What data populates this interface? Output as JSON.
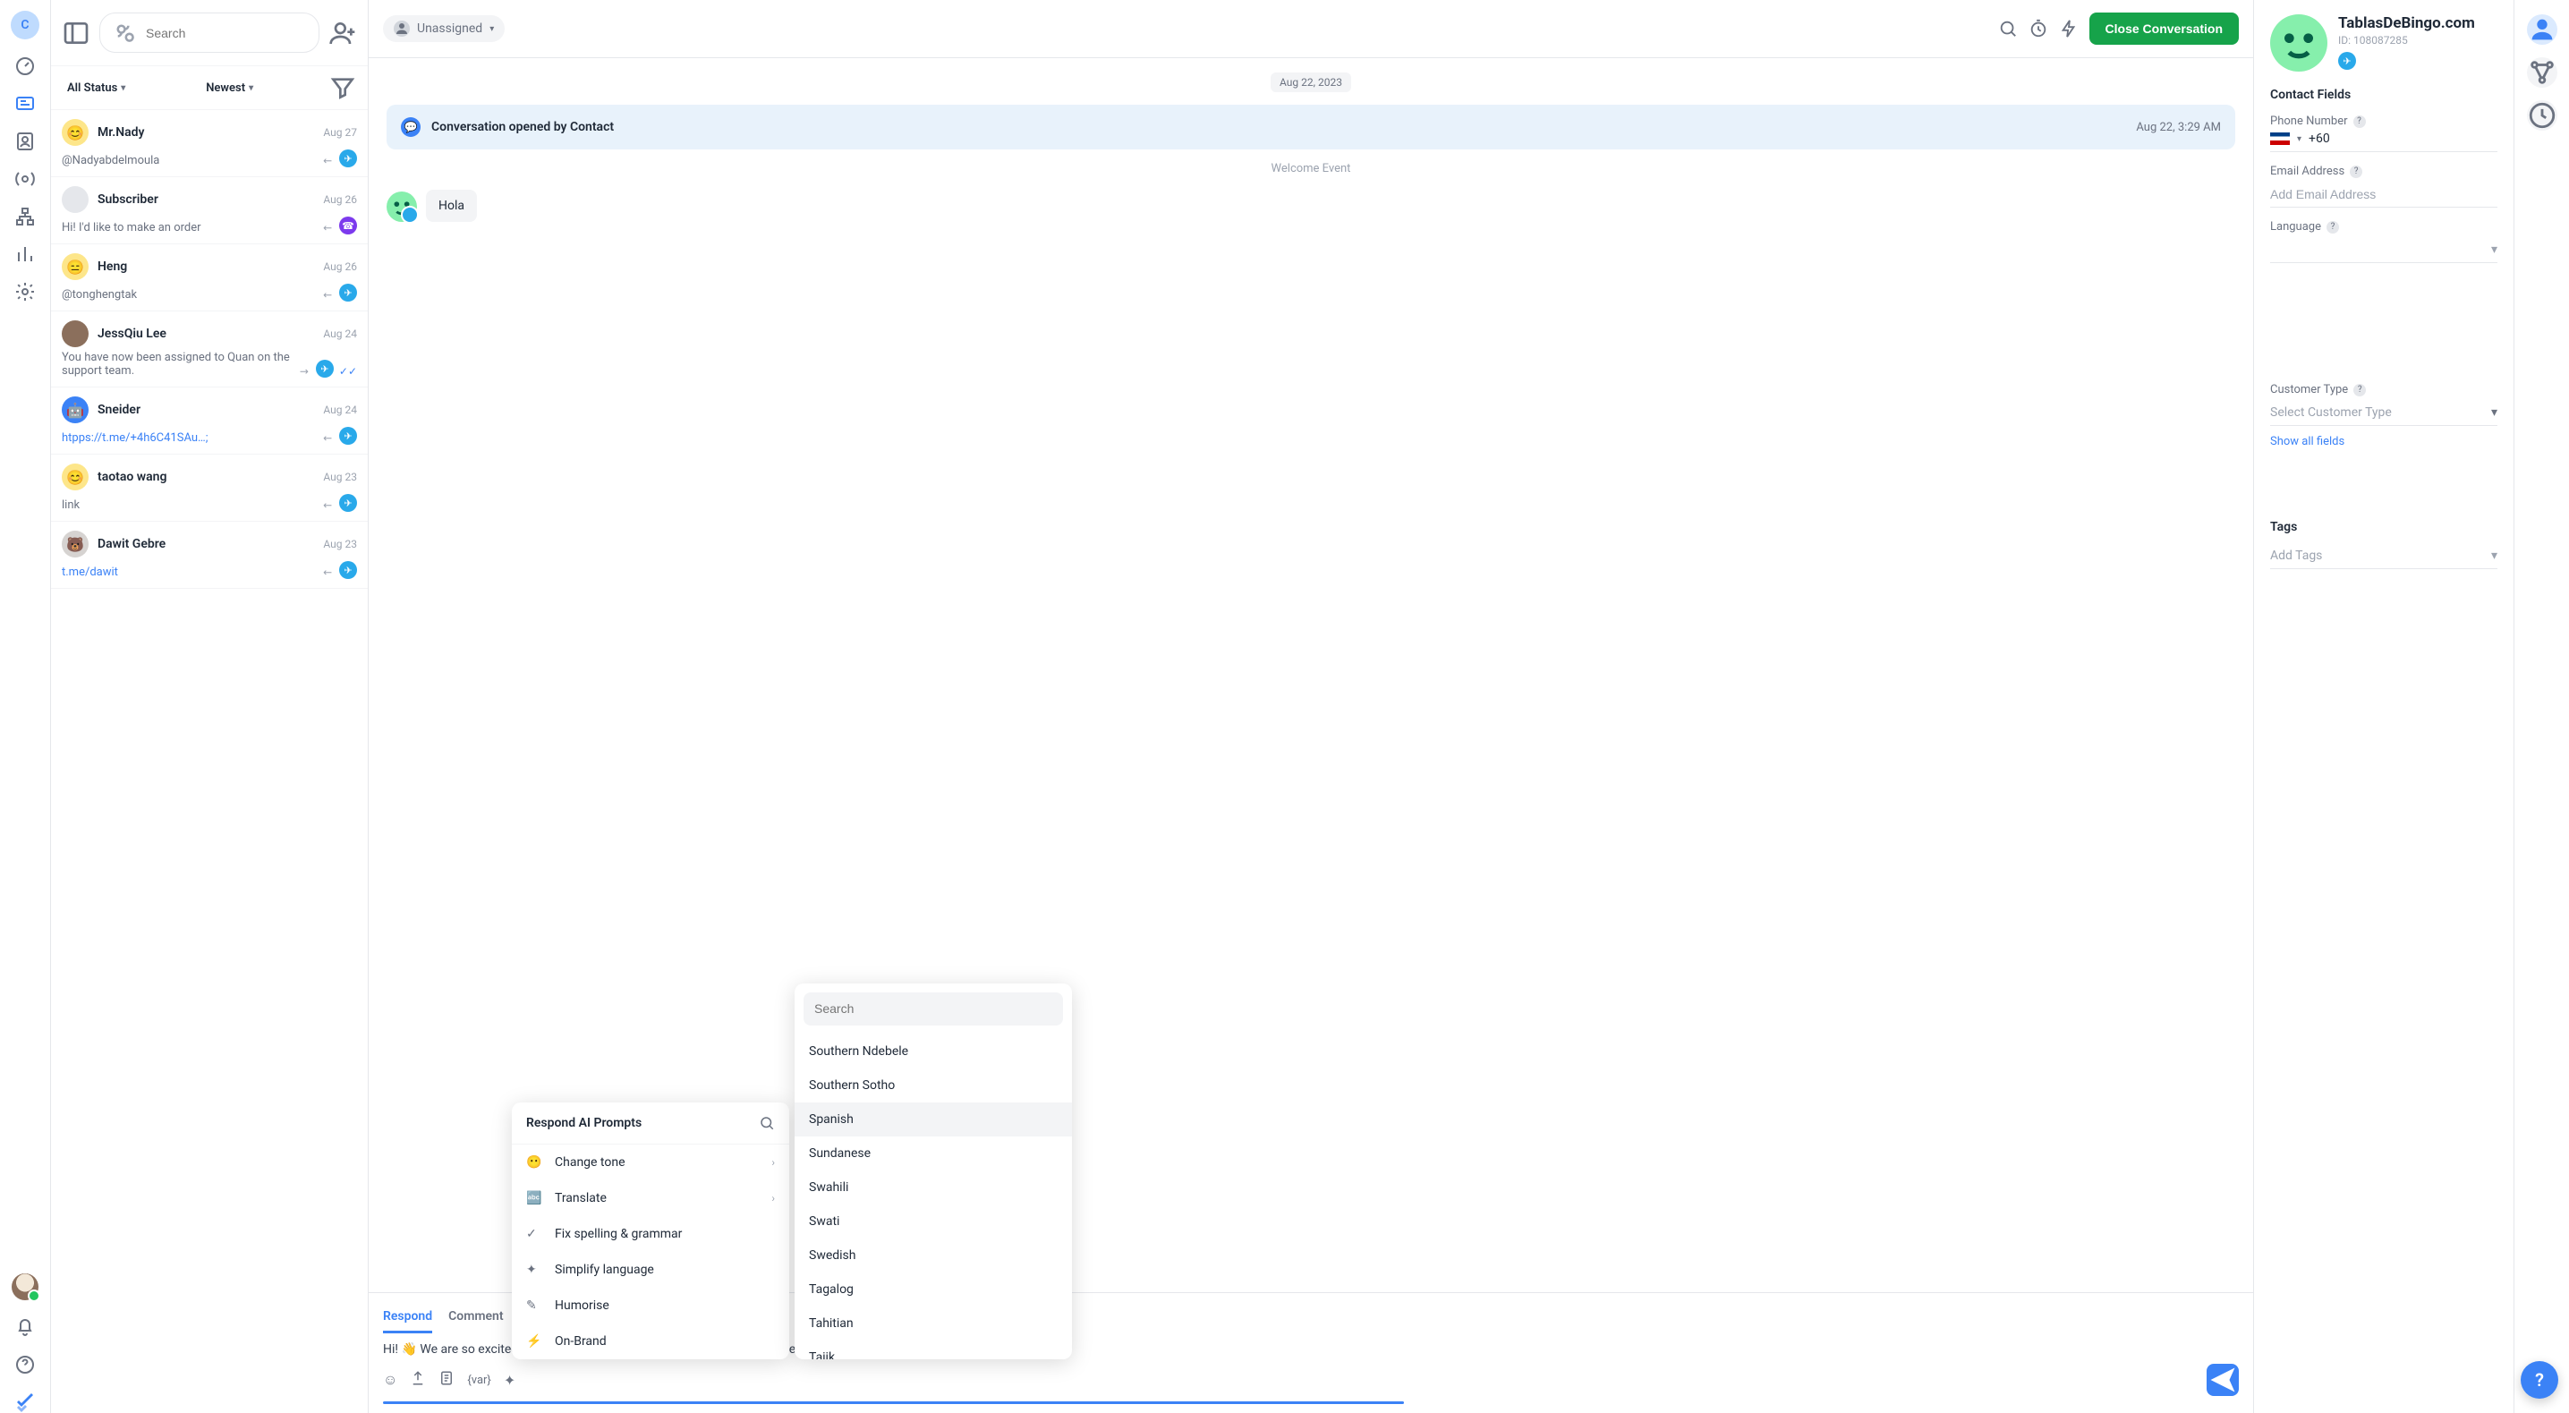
{
  "nav": {
    "workspace_initial": "C"
  },
  "list": {
    "search_placeholder": "Search",
    "filter_status": "All Status",
    "filter_sort": "Newest",
    "items": [
      {
        "name": "Mr.Nady",
        "date": "Aug 27",
        "preview": "@Nadyabdelmoula",
        "channel": "telegram",
        "dir": "in",
        "avatar": "😊"
      },
      {
        "name": "Subscriber",
        "date": "Aug 26",
        "preview": "Hi! I'd like to make an order",
        "channel": "viber",
        "dir": "in",
        "avatar": ""
      },
      {
        "name": "Heng",
        "date": "Aug 26",
        "preview": "@tonghengtak",
        "channel": "telegram",
        "dir": "in",
        "avatar": "😑"
      },
      {
        "name": "JessQiu Lee",
        "date": "Aug 24",
        "preview": "You have now been assigned to Quan on the support team.",
        "channel": "telegram",
        "dir": "out",
        "read": true,
        "avatar": "img"
      },
      {
        "name": "Sneider",
        "date": "Aug 24",
        "preview": "htpps://t.me/+4h6C41SAu…;",
        "channel": "telegram",
        "dir": "in",
        "link": true,
        "avatar": "🤖"
      },
      {
        "name": "taotao wang",
        "date": "Aug 23",
        "preview": "link",
        "channel": "telegram",
        "dir": "in",
        "avatar": "😊"
      },
      {
        "name": "Dawit Gebre",
        "date": "Aug 23",
        "preview": "t.me/dawit",
        "channel": "telegram",
        "dir": "in",
        "link": true,
        "avatar": "🐻"
      }
    ]
  },
  "conversation": {
    "assignee": "Unassigned",
    "close_label": "Close Conversation",
    "date": "Aug 22, 2023",
    "system_event": "Conversation opened by Contact",
    "system_time": "Aug 22, 3:29 AM",
    "welcome_label": "Welcome Event",
    "message": "Hola"
  },
  "composer": {
    "tabs": {
      "respond": "Respond",
      "comment": "Comment"
    },
    "draft": "Hi! 👋 We are so excited to have you here! To get started, please select the business si",
    "ai": {
      "title": "Respond AI Prompts",
      "items": [
        {
          "label": "Change tone",
          "sub": true
        },
        {
          "label": "Translate",
          "sub": true
        },
        {
          "label": "Fix spelling & grammar"
        },
        {
          "label": "Simplify language"
        },
        {
          "label": "Humorise"
        },
        {
          "label": "On-Brand"
        }
      ]
    },
    "lang": {
      "search_placeholder": "Search",
      "options": [
        "Southern Ndebele",
        "Southern Sotho",
        "Spanish",
        "Sundanese",
        "Swahili",
        "Swati",
        "Swedish",
        "Tagalog",
        "Tahitian",
        "Tajik"
      ],
      "highlighted": "Spanish"
    }
  },
  "contact": {
    "name": "TablasDeBingo.com",
    "id_label": "ID: 108087285",
    "fields_title": "Contact Fields",
    "phone_label": "Phone Number",
    "phone_prefix": "+60",
    "email_label": "Email Address",
    "email_placeholder": "Add Email Address",
    "language_label": "Language",
    "customer_type_label": "Customer Type",
    "customer_type_placeholder": "Select Customer Type",
    "show_all": "Show all fields",
    "tags_label": "Tags",
    "tags_placeholder": "Add Tags"
  }
}
